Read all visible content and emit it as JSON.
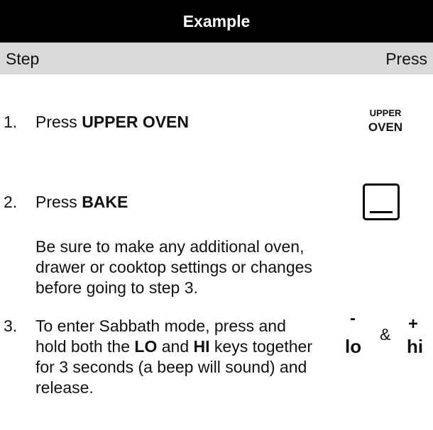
{
  "title": "Example",
  "header": {
    "step": "Step",
    "press": "Press"
  },
  "steps": [
    {
      "num": "1.",
      "pre": "Press ",
      "bold": "UPPER OVEN",
      "key": {
        "line1": "UPPER",
        "line2": "OVEN"
      }
    },
    {
      "num": "2.",
      "pre": "Press ",
      "bold": "BAKE",
      "note": "Be sure to make any additional oven, drawer or cooktop settings or changes before going to step 3."
    },
    {
      "num": "3.",
      "text_a": "To enter Sabbath mode, press and hold both the ",
      "bold_a": "LO",
      "text_b": " and ",
      "bold_b": "HI",
      "text_c": " keys together for 3 seconds (a beep will sound) and release.",
      "keys": {
        "lo_symbol": "-",
        "lo_label": "lo",
        "amp": "&",
        "hi_symbol": "+",
        "hi_label": "hi"
      }
    }
  ]
}
